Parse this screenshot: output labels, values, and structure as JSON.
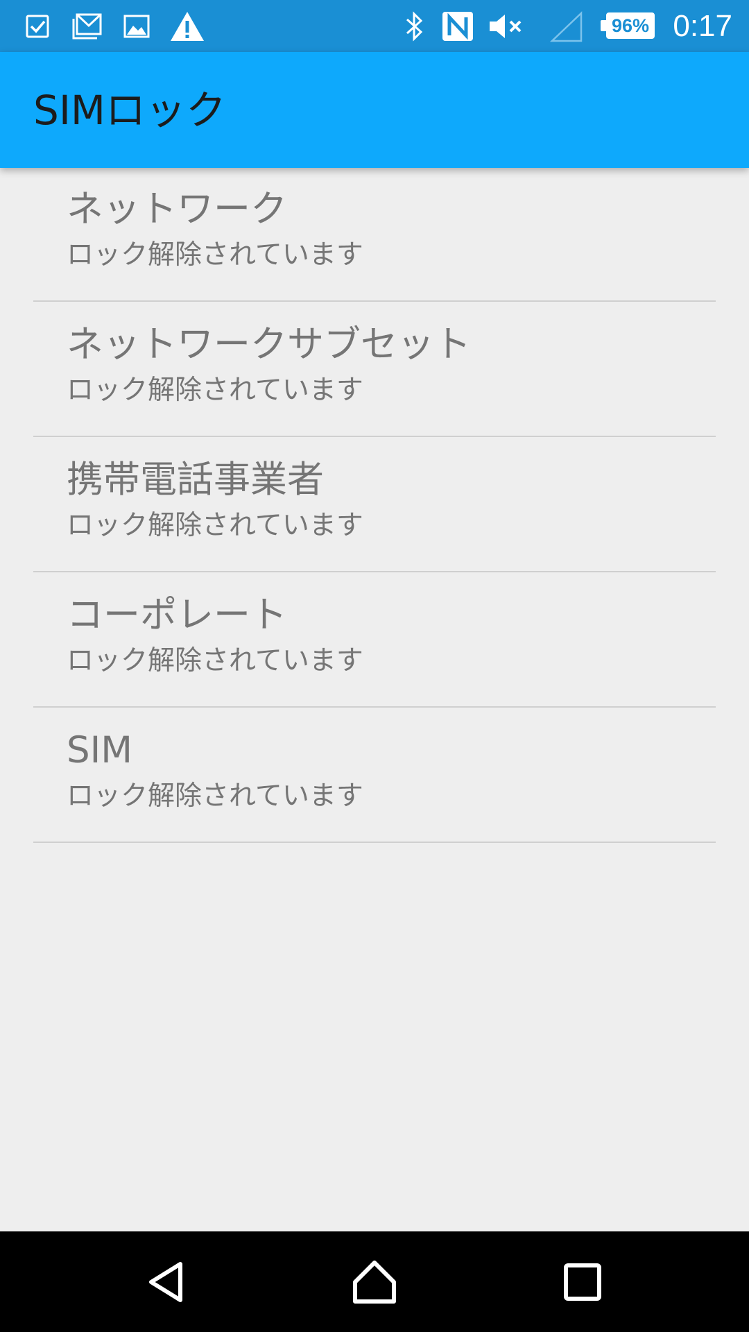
{
  "status_bar": {
    "time": "0:17",
    "battery_percent": "96%",
    "notification_icons": [
      "checkbox-icon",
      "mail-icon",
      "image-icon",
      "warning-icon"
    ],
    "system_icons": [
      "bluetooth-icon",
      "nfc-icon",
      "mute-icon",
      "signal-icon",
      "battery-icon"
    ]
  },
  "app_bar": {
    "title": "SIMロック",
    "color": "#0ea9fc"
  },
  "list": {
    "items": [
      {
        "title": "ネットワーク",
        "summary": "ロック解除されています"
      },
      {
        "title": "ネットワークサブセット",
        "summary": "ロック解除されています"
      },
      {
        "title": "携帯電話事業者",
        "summary": "ロック解除されています"
      },
      {
        "title": "コーポレート",
        "summary": "ロック解除されています"
      },
      {
        "title": "SIM",
        "summary": "ロック解除されています"
      }
    ]
  },
  "nav_bar": {
    "buttons": [
      "back-icon",
      "home-icon",
      "recents-icon"
    ]
  }
}
